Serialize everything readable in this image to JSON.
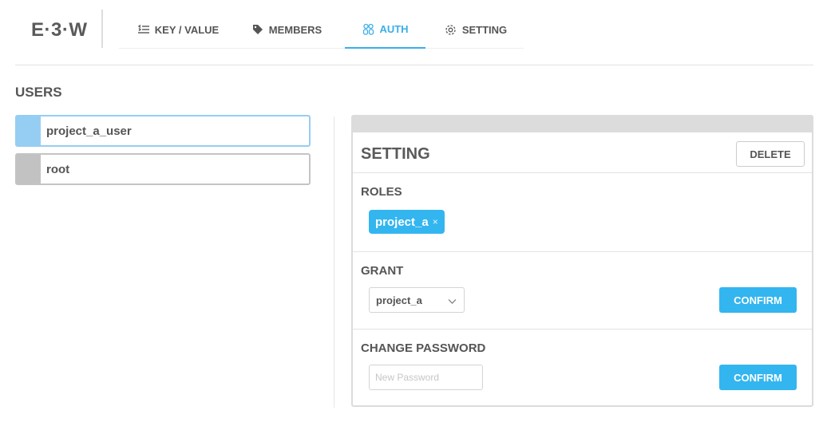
{
  "app": {
    "logo": "E·3·W"
  },
  "nav": {
    "tabs": [
      {
        "label": "KEY / VALUE",
        "icon": "list-icon"
      },
      {
        "label": "MEMBERS",
        "icon": "tag-icon"
      },
      {
        "label": "AUTH",
        "icon": "people-icon",
        "active": true
      },
      {
        "label": "SETTING",
        "icon": "gear-icon"
      }
    ]
  },
  "colors": {
    "accent": "#3aaee8",
    "button": "#33b5ef",
    "selected_user": "#96cdf3",
    "unselected_user": "#c2c2c2"
  },
  "users": {
    "title": "USERS",
    "items": [
      {
        "name": "project_a_user",
        "selected": true
      },
      {
        "name": "root",
        "selected": false
      }
    ]
  },
  "setting": {
    "title": "SETTING",
    "delete_label": "DELETE",
    "roles": {
      "title": "ROLES",
      "tags": [
        {
          "name": "project_a",
          "close": "×"
        }
      ]
    },
    "grant": {
      "title": "GRANT",
      "selected": "project_a",
      "confirm_label": "CONFIRM"
    },
    "password": {
      "title": "CHANGE PASSWORD",
      "placeholder": "New Password",
      "value": "",
      "confirm_label": "CONFIRM"
    }
  }
}
